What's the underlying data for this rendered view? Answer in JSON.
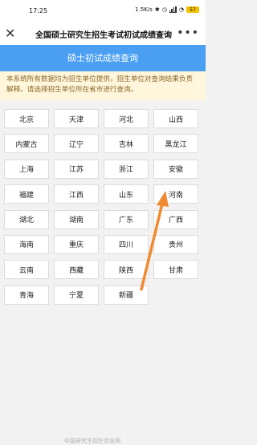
{
  "status": {
    "time": "17:25",
    "net_speed": "1.5K/s",
    "battery": "57"
  },
  "nav": {
    "close_glyph": "✕",
    "title": "全国硕士研究生招生考试初试成绩查询",
    "more_glyph": "•••"
  },
  "banner": {
    "title": "硕士初试成绩查询"
  },
  "notice": {
    "text": "本系统所有数据均为招生单位提供，招生单位对查询结果负责解释。请选择招生单位所在省市进行查询。"
  },
  "provinces": [
    "北京",
    "天津",
    "河北",
    "山西",
    "内蒙古",
    "辽宁",
    "吉林",
    "黑龙江",
    "上海",
    "江苏",
    "浙江",
    "安徽",
    "福建",
    "江西",
    "山东",
    "河南",
    "湖北",
    "湖南",
    "广东",
    "广西",
    "海南",
    "重庆",
    "四川",
    "贵州",
    "云南",
    "西藏",
    "陕西",
    "甘肃",
    "青海",
    "宁夏",
    "新疆"
  ],
  "annotation": {
    "color": "#f08a30"
  },
  "footer": {
    "text": "中国研究生招生信息网"
  }
}
